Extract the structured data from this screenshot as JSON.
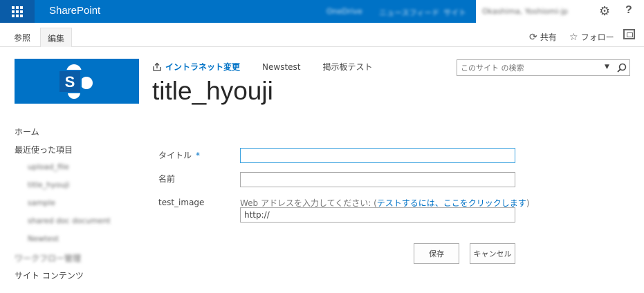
{
  "suite_bar": {
    "brand": "SharePoint",
    "links": [
      "OneDrive",
      "ニュースフィード",
      "サイト"
    ],
    "user": "Okashima, Yoshiomi-jp"
  },
  "ribbon": {
    "tabs": [
      "参照",
      "編集"
    ],
    "share": "共有",
    "follow": "フォロー"
  },
  "header": {
    "edit_links": "イントラネット変更",
    "nav": [
      "Newstest",
      "掲示板テスト"
    ],
    "site_title": "title_hyouji"
  },
  "search": {
    "placeholder": "このサイト の検索"
  },
  "left_nav": {
    "home": "ホーム",
    "recent": "最近使った項目",
    "recent_items": [
      "upload_file",
      "title_hyouji",
      "sample",
      "shared doc document",
      "Newtest"
    ],
    "blurred": "ワークフロー管理",
    "site_contents": "サイト コンテンツ"
  },
  "form": {
    "title_label": "タイトル",
    "required_mark": "*",
    "title_value": "",
    "name_label": "名前",
    "name_value": "",
    "image_label": "test_image",
    "hint_prefix": "Web アドレスを入力してください: (",
    "hint_link": "テストするには、ここをクリックします",
    "hint_suffix": ")",
    "image_value": "http://",
    "save": "保存",
    "cancel": "キャンセル"
  }
}
